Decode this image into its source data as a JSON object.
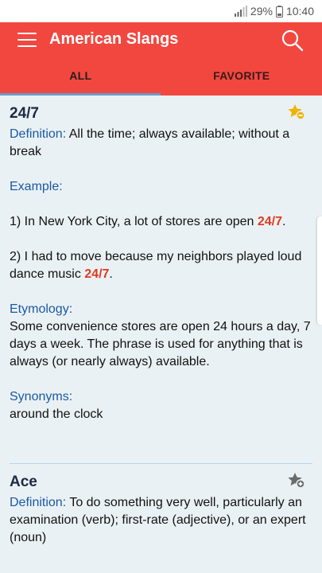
{
  "status": {
    "battery": "29%",
    "time": "10:40"
  },
  "appbar": {
    "title": "American Slangs"
  },
  "tabs": [
    {
      "label": "ALL",
      "active": true
    },
    {
      "label": "FAVORITE",
      "active": false
    }
  ],
  "entries": [
    {
      "word": "24/7",
      "definition_label": "Definition:",
      "definition": "All the time; always available; without a break",
      "example_label": "Example:",
      "ex1_pre": "1) In New York City, a lot of stores are open",
      "ex1_hl": "24/7",
      "ex1_post": ".",
      "ex2_pre": "2) I had to move because my neighbors played loud dance music",
      "ex2_hl": "24/7",
      "ex2_post": ".",
      "etymology_label": "Etymology:",
      "etymology": "Some convenience stores are open 24 hours a day, 7 days a week. The phrase is used for anything that is always (or nearly always) available.",
      "synonyms_label": "Synonyms:",
      "synonyms": "around the clock"
    },
    {
      "word": "Ace",
      "definition_label": "Definition:",
      "definition": "To do something very well, particularly an examination (verb); first-rate (adjective), or an expert (noun)"
    }
  ],
  "colors": {
    "primary": "#f2473f",
    "label": "#1a5aa2",
    "highlight": "#e03a1e",
    "star_active": "#f0b400",
    "star_inactive": "#6b6b6b"
  },
  "icons": {
    "menu": "hamburger-icon",
    "search": "search-icon",
    "fav_active": "star-remove-icon",
    "fav_inactive": "star-add-icon"
  }
}
